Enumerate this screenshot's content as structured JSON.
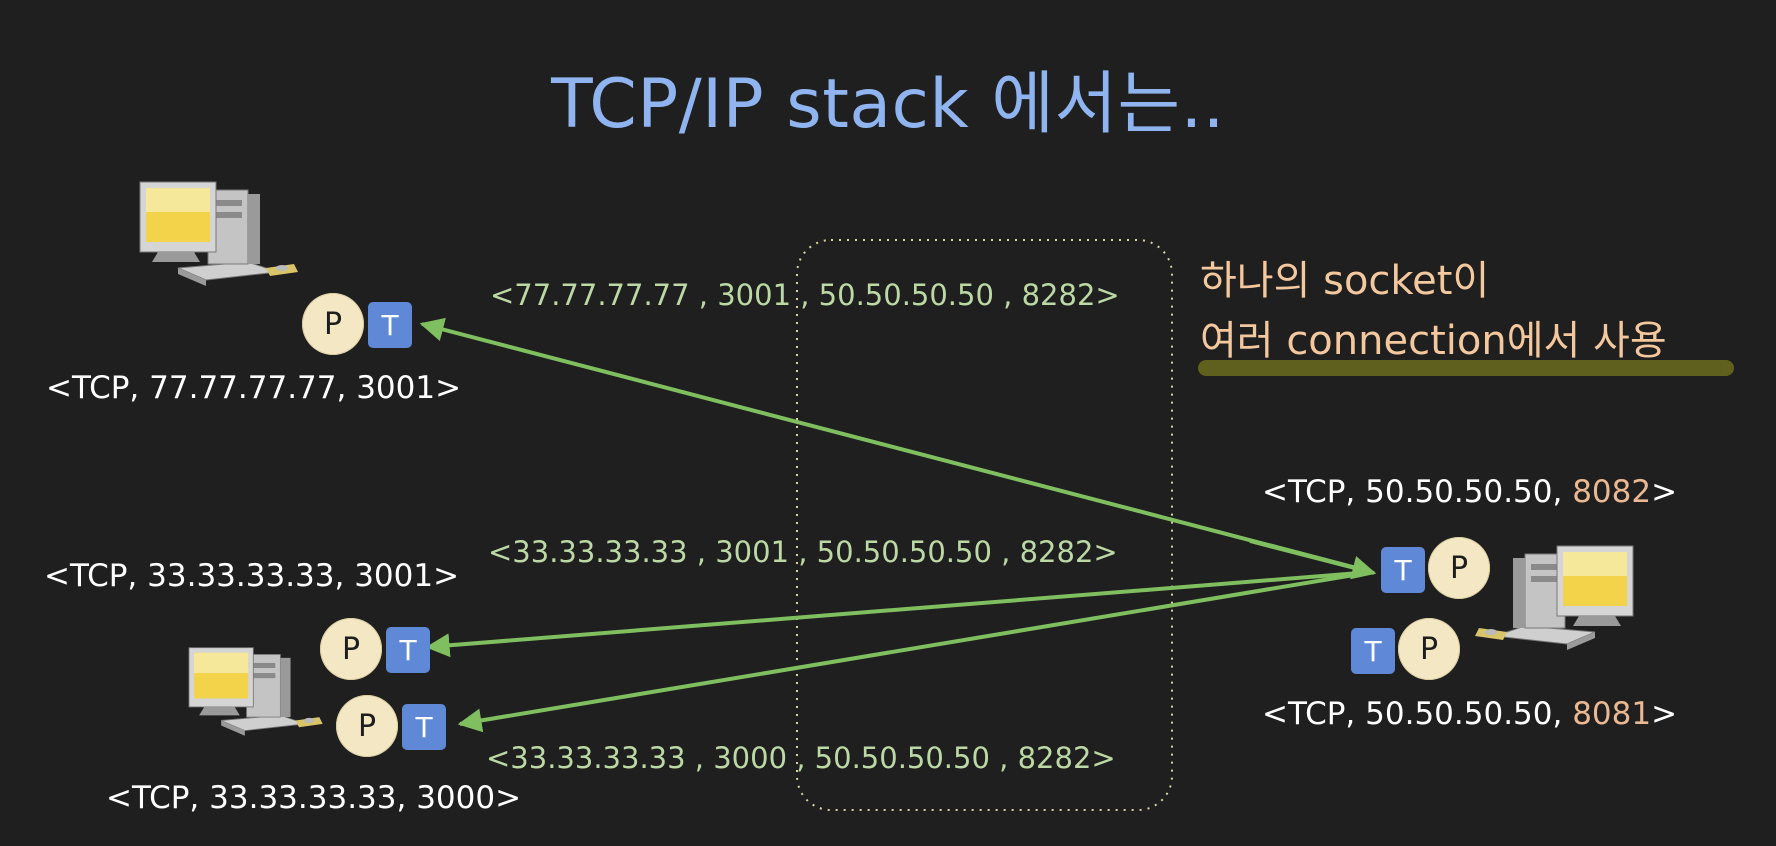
{
  "title": "TCP/IP stack 에서는..",
  "note": {
    "line1": "하나의 socket이",
    "line2": "여러 connection에서 사용"
  },
  "client1": {
    "socket_label": "<TCP, 77.77.77.77, 3001>",
    "process_letter": "P",
    "tcp_letter": "T"
  },
  "client2": {
    "socket_a_label": "<TCP, 33.33.33.33, 3001>",
    "socket_b_label": "<TCP, 33.33.33.33, 3000>",
    "process_letter": "P",
    "tcp_letter": "T"
  },
  "server": {
    "socket_a_prefix": "<TCP, 50.50.50.50, ",
    "socket_a_port": "8082",
    "socket_b_prefix": "<TCP, 50.50.50.50, ",
    "socket_b_port": "8081",
    "suffix": ">",
    "process_letter": "P",
    "tcp_letter": "T"
  },
  "connections": [
    "<77.77.77.77 , 3001 , 50.50.50.50 , 8282>",
    "<33.33.33.33 , 3001 , 50.50.50.50 , 8282>",
    "<33.33.33.33 , 3000 , 50.50.50.50 , 8282>"
  ],
  "colors": {
    "background": "#1f1f1f",
    "title": "#8fb4ef",
    "arrow": "#7fbf5f",
    "tuple_text": "#bcd9a5",
    "note_text": "#f4c89e",
    "underline": "#5f5f1e",
    "process_circle": "#f3e8c3",
    "tcp_box": "#5f88d6",
    "port_highlight": "#eab892"
  }
}
